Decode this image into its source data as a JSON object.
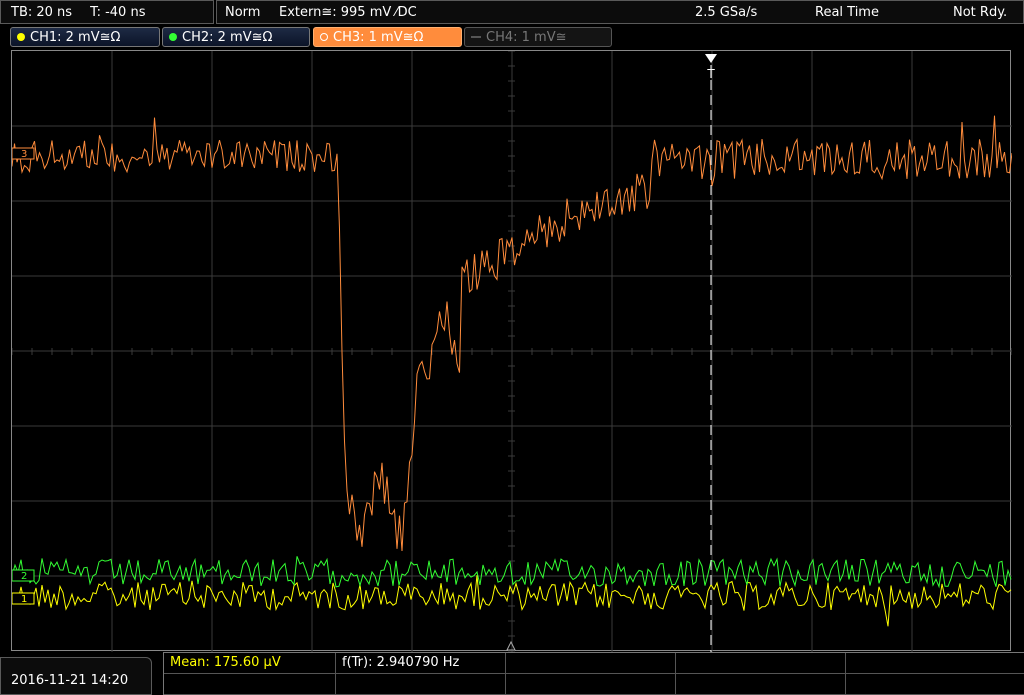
{
  "header": {
    "timebase": "TB: 20 ns",
    "trigger_time": "T: -40 ns",
    "mode": "Norm",
    "trigger_source": "Extern≅: 995 mV ⁄DC",
    "sample_rate": "2.5 GSa/s",
    "acq_mode": "Real Time",
    "status": "Not Rdy."
  },
  "channels": [
    {
      "label": "CH1: 2 mV≅Ω",
      "color": "#ffff00"
    },
    {
      "label": "CH2: 2 mV≅Ω",
      "color": "#33ff33"
    },
    {
      "label": "CH3: 1 mV≅Ω",
      "color": "#ff8c3c"
    },
    {
      "label": "CH4: 1 mV≅",
      "color": "#777777"
    }
  ],
  "markers": {
    "trigger": "T",
    "ch3": "3",
    "ch2": "2",
    "ch1": "1"
  },
  "footer": {
    "datetime": "2016-11-21 14:20",
    "mean": "Mean: 175.60 µV",
    "freq": "f(Tr): 2.940790 Hz"
  },
  "colors": {
    "ch1": "#ffff00",
    "ch2": "#33ff33",
    "ch3": "#ff8c3c",
    "grid": "#3a3a3a",
    "mean_text": "#ffff00"
  }
}
